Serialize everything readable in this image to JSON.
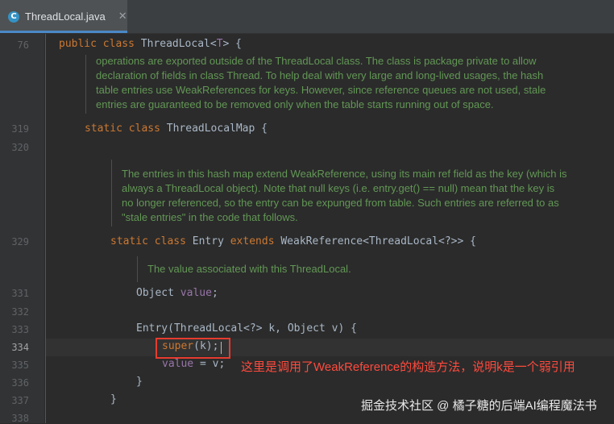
{
  "tab": {
    "title": "ThreadLocal.java",
    "icon": "C",
    "close": "✕"
  },
  "line_numbers": [
    "76",
    "319",
    "320",
    "329",
    "331",
    "332",
    "333",
    "334",
    "335",
    "336",
    "337",
    "338"
  ],
  "code": {
    "l76": {
      "kw1": "public",
      "kw2": "class",
      "name": "ThreadLocal<",
      "tp": "T",
      "tail": "> {"
    },
    "l319": {
      "kw1": "static",
      "kw2": "class",
      "name": "ThreadLocalMap {"
    },
    "l329": {
      "kw1": "static",
      "kw2": "class",
      "name": "Entry ",
      "kw3": "extends",
      "tail": " WeakReference<ThreadLocal<?>> {"
    },
    "l331": {
      "type": "Object ",
      "field": "value",
      "tail": ";"
    },
    "l333": {
      "text": "Entry(ThreadLocal<?> k, Object v) {"
    },
    "l334": {
      "kw": "super",
      "tail": "(k);"
    },
    "l335": {
      "field": "value",
      "tail": " = v;"
    },
    "l336": {
      "text": "}"
    },
    "l337": {
      "text": "}"
    }
  },
  "docs": {
    "d1": [
      "operations are exported outside of the ThreadLocal class. The class is package private to allow",
      "declaration of fields in class Thread. To help deal with very large and long-lived usages, the hash",
      "table entries use WeakReferences for keys. However, since reference queues are not used, stale",
      "entries are guaranteed to be removed only when the table starts running out of space."
    ],
    "d2": [
      "The entries in this hash map extend WeakReference, using its main ref field as the key (which is",
      "always a ThreadLocal object). Note that null keys (i.e. entry.get() == null) mean that the key is",
      "no longer referenced, so the entry can be expunged from table. Such entries are referred to as",
      "\"stale entries\" in the code that follows."
    ],
    "d3": [
      "The value associated with this ThreadLocal."
    ]
  },
  "annotation": "这里是调用了WeakReference的构造方法，说明k是一个弱引用",
  "watermark": "掘金技术社区 @ 橘子糖的后端AI编程魔法书",
  "colors": {
    "background": "#2b2b2b",
    "keyword": "#cc7832",
    "doc": "#629755",
    "annotation": "#e53c2f"
  }
}
